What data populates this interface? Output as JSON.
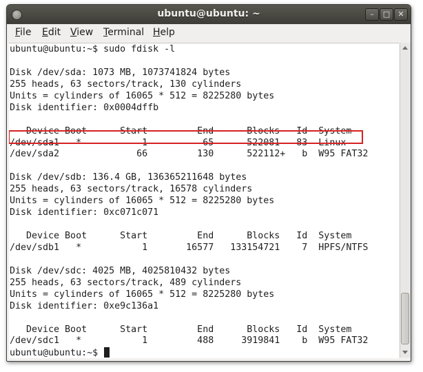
{
  "window": {
    "title": "ubuntu@ubuntu: ~"
  },
  "window_controls": {
    "minimize": "–",
    "maximize": "□",
    "close": "✕"
  },
  "menubar": {
    "items": [
      {
        "mnemonic": "F",
        "rest": "ile"
      },
      {
        "mnemonic": "E",
        "rest": "dit"
      },
      {
        "mnemonic": "V",
        "rest": "iew"
      },
      {
        "mnemonic": "T",
        "rest": "erminal"
      },
      {
        "mnemonic": "H",
        "rest": "elp"
      }
    ]
  },
  "terminal": {
    "lines": [
      "ubuntu@ubuntu:~$ sudo fdisk -l",
      "",
      "Disk /dev/sda: 1073 MB, 1073741824 bytes",
      "255 heads, 63 sectors/track, 130 cylinders",
      "Units = cylinders of 16065 * 512 = 8225280 bytes",
      "Disk identifier: 0x0004dffb",
      "",
      "   Device Boot      Start         End      Blocks   Id  System",
      "/dev/sda1   *           1          65      522081   83  Linux",
      "/dev/sda2              66         130      522112+   b  W95 FAT32",
      "",
      "Disk /dev/sdb: 136.4 GB, 136365211648 bytes",
      "255 heads, 63 sectors/track, 16578 cylinders",
      "Units = cylinders of 16065 * 512 = 8225280 bytes",
      "Disk identifier: 0xc071c071",
      "",
      "   Device Boot      Start         End      Blocks   Id  System",
      "/dev/sdb1   *           1       16577   133154721    7  HPFS/NTFS",
      "",
      "Disk /dev/sdc: 4025 MB, 4025810432 bytes",
      "255 heads, 63 sectors/track, 489 cylinders",
      "Units = cylinders of 16065 * 512 = 8225280 bytes",
      "Disk identifier: 0xe9c136a1",
      "",
      "   Device Boot      Start         End      Blocks   Id  System",
      "/dev/sdc1   *           1         488     3919841    b  W95 FAT32",
      "ubuntu@ubuntu:~$ "
    ]
  },
  "colors": {
    "titlebar": "#3d3c37",
    "terminal_background": "#ffffff",
    "terminal_text": "#1e1e1e",
    "highlight_box": "#d52020"
  }
}
